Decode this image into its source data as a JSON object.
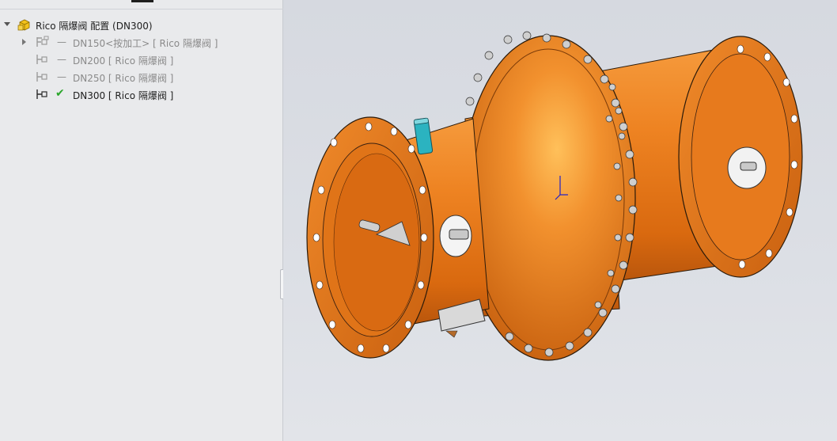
{
  "feature_tree": {
    "root": {
      "label": "Rico 隔爆阀 配置  (DN300)",
      "icon": "assembly-config-icon",
      "expanded": true
    },
    "configs": [
      {
        "label": "DN150<按加工> [ Rico 隔爆阀 ]",
        "icon": "config-icon",
        "active": false,
        "dash": "—",
        "expandable": true
      },
      {
        "label": "DN200 [ Rico 隔爆阀 ]",
        "icon": "config-icon",
        "active": false,
        "dash": "—",
        "expandable": false
      },
      {
        "label": "DN250 [ Rico 隔爆阀 ]",
        "icon": "config-icon",
        "active": false,
        "dash": "—",
        "expandable": false
      },
      {
        "label": "DN300 [ Rico 隔爆阀 ]",
        "icon": "config-icon",
        "active": true,
        "status_icon": "checkmark-icon",
        "expandable": false
      }
    ]
  },
  "colors": {
    "model_orange": "#e8791c",
    "model_orange_dark": "#b9560c",
    "sensor_teal": "#2bb3c0",
    "active_check": "#2aa62a",
    "inactive_text": "#8a8a8a"
  }
}
